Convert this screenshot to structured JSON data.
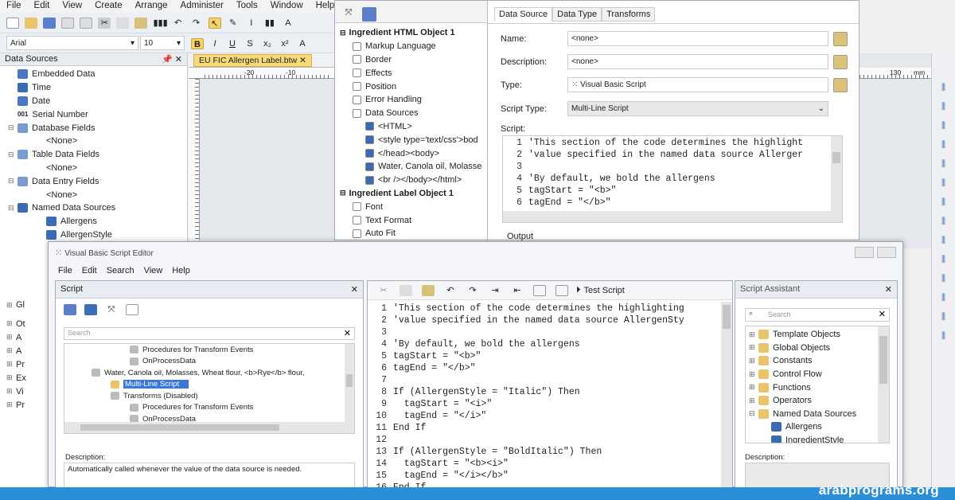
{
  "menu": [
    "File",
    "Edit",
    "View",
    "Create",
    "Arrange",
    "Administer",
    "Tools",
    "Window",
    "Help"
  ],
  "font": {
    "name": "Arial",
    "size": "10"
  },
  "format_buttons": [
    "B",
    "I",
    "U",
    "S",
    "x₂",
    "x²",
    "A"
  ],
  "doc_tab": "EU FIC Allergen Label.btw",
  "ruler_marks": [
    "-20",
    "-10",
    "130",
    "mm"
  ],
  "data_sources_panel": {
    "title": "Data Sources",
    "items": [
      {
        "label": "Embedded Data",
        "indent": 1
      },
      {
        "label": "Time",
        "indent": 1
      },
      {
        "label": "Date",
        "indent": 1
      },
      {
        "label": "Serial Number",
        "indent": 1,
        "prefix": "001"
      },
      {
        "label": "Database Fields",
        "indent": 0,
        "expand": "⊟"
      },
      {
        "label": "<None>",
        "indent": 2
      },
      {
        "label": "Table Data Fields",
        "indent": 0,
        "expand": "⊟"
      },
      {
        "label": "<None>",
        "indent": 2
      },
      {
        "label": "Data Entry Fields",
        "indent": 0,
        "expand": "⊟"
      },
      {
        "label": "<None>",
        "indent": 2
      },
      {
        "label": "Named Data Sources",
        "indent": 0,
        "expand": "⊟"
      },
      {
        "label": "Allergens",
        "indent": 2
      },
      {
        "label": "AllergenStyle",
        "indent": 2
      }
    ],
    "lower_items": [
      "Gl",
      "Ot",
      "A",
      "A",
      "Pr",
      "Ex",
      "Vi",
      "Pr"
    ]
  },
  "props_tree": {
    "items": [
      {
        "label": "Ingredient HTML Object 1",
        "indent": 0,
        "bold": true
      },
      {
        "label": "Markup Language",
        "indent": 1
      },
      {
        "label": "Border",
        "indent": 1
      },
      {
        "label": "Effects",
        "indent": 1
      },
      {
        "label": "Position",
        "indent": 1
      },
      {
        "label": "Error Handling",
        "indent": 1
      },
      {
        "label": "Data Sources",
        "indent": 1
      },
      {
        "label": "<HTML>",
        "indent": 2
      },
      {
        "label": "<style type='text/css'>bod",
        "indent": 2
      },
      {
        "label": "</head><body>",
        "indent": 2
      },
      {
        "label": "Water, Canola oil, Molasse",
        "indent": 2
      },
      {
        "label": "<br /></body></html>",
        "indent": 2
      },
      {
        "label": "Ingredient Label Object 1",
        "indent": 0,
        "bold": true
      },
      {
        "label": "Font",
        "indent": 1
      },
      {
        "label": "Text Format",
        "indent": 1
      },
      {
        "label": "Auto Fit",
        "indent": 1
      }
    ]
  },
  "props_tabs": [
    "Data Source",
    "Data Type",
    "Transforms"
  ],
  "props_form": {
    "name_label": "Name:",
    "name_value": "<none>",
    "desc_label": "Description:",
    "desc_value": "<none>",
    "type_label": "Type:",
    "type_value": "Visual Basic Script",
    "script_type_label": "Script Type:",
    "script_type_value": "Multi-Line Script",
    "script_label": "Script:",
    "output_label": "Output"
  },
  "props_script": [
    {
      "n": "1",
      "t": "'This section of the code determines the highlight"
    },
    {
      "n": "2",
      "t": "'value specified in the named data source Allerger"
    },
    {
      "n": "3",
      "t": ""
    },
    {
      "n": "4",
      "t": "'By default, we bold the allergens"
    },
    {
      "n": "5",
      "t": "tagStart = \"<b>\""
    },
    {
      "n": "6",
      "t": "tagEnd = \"</b>\""
    }
  ],
  "vbs": {
    "title": "Visual Basic Script Editor",
    "menu": [
      "File",
      "Edit",
      "Search",
      "View",
      "Help"
    ],
    "script_panel_title": "Script",
    "search_placeholder": "Search",
    "tree": [
      {
        "label": "Procedures for Transform Events",
        "indent": 3
      },
      {
        "label": "OnProcessData",
        "indent": 3
      },
      {
        "label": "Water, Canola oil, Molasses, Wheat flour, <b>Rye</b> flour,",
        "indent": 1
      },
      {
        "label": "Multi-Line Script",
        "indent": 2,
        "selected": true
      },
      {
        "label": "Transforms (Disabled)",
        "indent": 2
      },
      {
        "label": "Procedures for Transform Events",
        "indent": 3
      },
      {
        "label": "OnProcessData",
        "indent": 3
      }
    ],
    "description_label": "Description:",
    "description_text": "Automatically called whenever the value of the data source is needed.",
    "test_script": "Test Script",
    "code": [
      {
        "n": "1",
        "t": "'This section of the code determines the highlighting"
      },
      {
        "n": "2",
        "t": "'value specified in the named data source AllergenSty"
      },
      {
        "n": "3",
        "t": ""
      },
      {
        "n": "4",
        "t": "'By default, we bold the allergens"
      },
      {
        "n": "5",
        "t": "tagStart = \"<b>\""
      },
      {
        "n": "6",
        "t": "tagEnd = \"</b>\""
      },
      {
        "n": "7",
        "t": ""
      },
      {
        "n": "8",
        "t": "If (AllergenStyle = \"Italic\") Then"
      },
      {
        "n": "9",
        "t": "  tagStart = \"<i>\""
      },
      {
        "n": "10",
        "t": "  tagEnd = \"</i>\""
      },
      {
        "n": "11",
        "t": "End If"
      },
      {
        "n": "12",
        "t": ""
      },
      {
        "n": "13",
        "t": "If (AllergenStyle = \"BoldItalic\") Then"
      },
      {
        "n": "14",
        "t": "  tagStart = \"<b><i>\""
      },
      {
        "n": "15",
        "t": "  tagEnd = \"</i></b>\""
      },
      {
        "n": "16",
        "t": "End If"
      }
    ],
    "assistant_title": "Script Assistant",
    "assistant_search": "Search",
    "assistant_items": [
      {
        "label": "Template Objects",
        "indent": 0
      },
      {
        "label": "Global Objects",
        "indent": 0
      },
      {
        "label": "Constants",
        "indent": 0
      },
      {
        "label": "Control Flow",
        "indent": 0
      },
      {
        "label": "Functions",
        "indent": 0
      },
      {
        "label": "Operators",
        "indent": 0
      },
      {
        "label": "Named Data Sources",
        "indent": 0,
        "open": true
      },
      {
        "label": "Allergens",
        "indent": 1
      },
      {
        "label": "IngredientStyle",
        "indent": 1
      }
    ],
    "assistant_description": "Description:"
  },
  "watermark": "arabprograms.org",
  "colors": {
    "accent": "#2b8fd8",
    "selected": "#3a78d8",
    "folder": "#e9c46a"
  }
}
